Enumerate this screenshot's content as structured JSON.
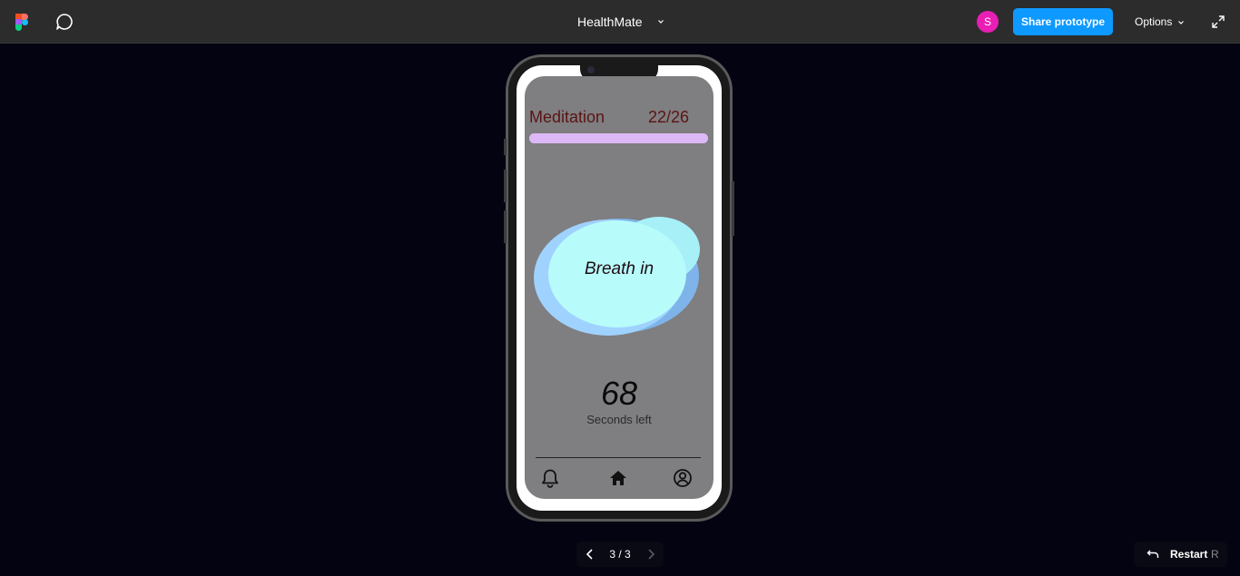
{
  "topbar": {
    "file_title": "HealthMate",
    "avatar_initial": "S",
    "share_label": "Share prototype",
    "options_label": "Options"
  },
  "screen": {
    "title": "Meditation",
    "count": "22/26",
    "progress_fraction": 1.0,
    "breath_text": "Breath in",
    "seconds_value": "68",
    "seconds_label": "Seconds left"
  },
  "colors": {
    "topbar_bg": "#2c2c2c",
    "canvas_bg": "#030312",
    "share_button": "#0d99ff",
    "avatar": "#e91eb4",
    "screen_bg": "#7f7e80",
    "title_text": "#5a1414",
    "progress": "#dcb8f6",
    "blob_light": "#b8fbfb",
    "blob_mid": "#9fd2ff",
    "blob_dark": "#7fb4ea"
  },
  "nav": {
    "items": [
      "bell-icon",
      "home-icon",
      "profile-icon"
    ]
  },
  "pager": {
    "text": "3 / 3"
  },
  "restart": {
    "label": "Restart",
    "shortcut": "R"
  }
}
